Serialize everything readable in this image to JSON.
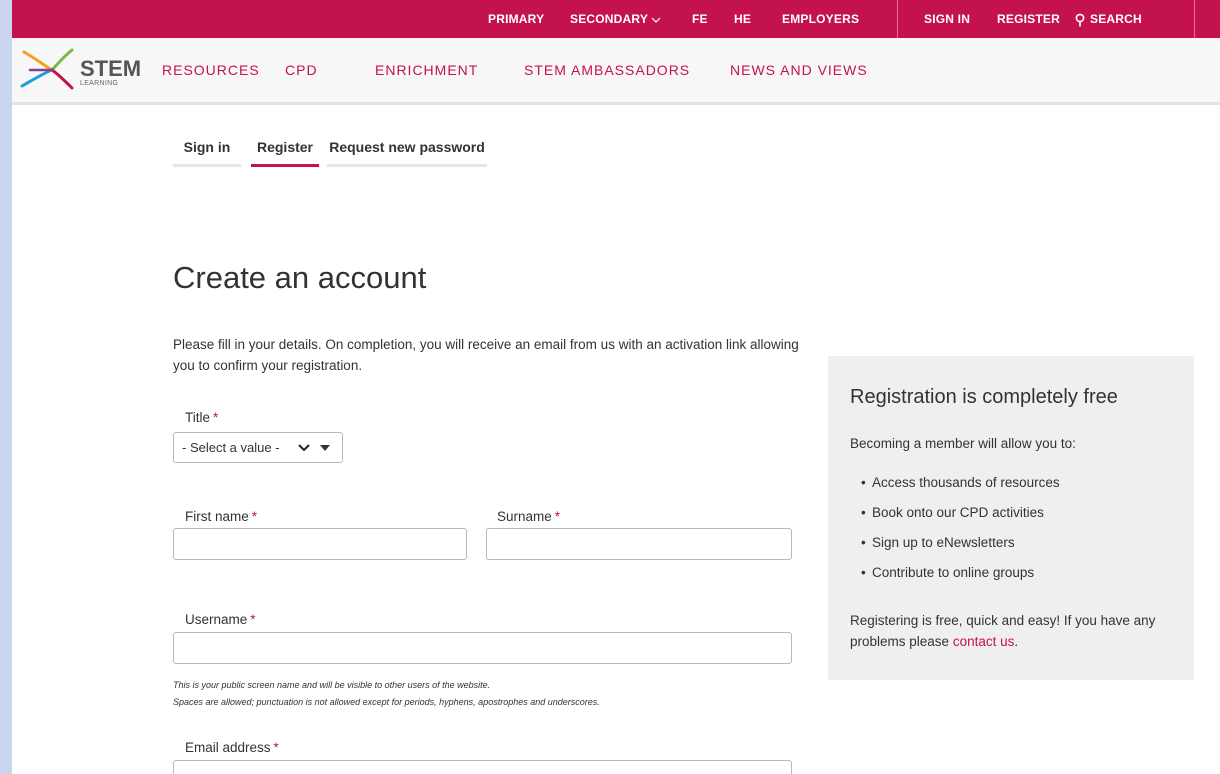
{
  "topbar": {
    "links": [
      "PRIMARY",
      "SECONDARY",
      "FE",
      "HE",
      "EMPLOYERS"
    ],
    "sign_in": "SIGN IN",
    "register": "REGISTER",
    "search": "SEARCH"
  },
  "logo": {
    "name": "STEM",
    "sub": "LEARNING"
  },
  "nav": [
    "RESOURCES",
    "CPD",
    "ENRICHMENT",
    "STEM AMBASSADORS",
    "NEWS AND VIEWS"
  ],
  "tabs": [
    "Sign in",
    "Register",
    "Request new password"
  ],
  "page_title": "Create an account",
  "intro": "Please fill in your details. On completion, you will receive an email from us with an activation link allowing you to confirm your registration.",
  "form": {
    "title_label": "Title",
    "title_value": "- Select a value -",
    "first_name_label": "First name",
    "surname_label": "Surname",
    "username_label": "Username",
    "username_help_1": "This is your public screen name and will be visible to other users of the website.",
    "username_help_2": "Spaces are allowed; punctuation is not allowed except for periods, hyphens, apostrophes and underscores.",
    "email_label": "Email address",
    "required_mark": "*"
  },
  "sidebar": {
    "title": "Registration is completely free",
    "lead": "Becoming a member will allow you to:",
    "items": [
      "Access thousands of resources",
      "Book onto our CPD activities",
      "Sign up to eNewsletters",
      "Contribute to online groups"
    ],
    "bullet": "•",
    "footer_text": "Registering is free, quick and easy! If you have any problems please",
    "footer_link": "contact us",
    "footer_end": "."
  },
  "colors": {
    "brand": "#c4124f",
    "sidebar_bg": "#efefef"
  }
}
